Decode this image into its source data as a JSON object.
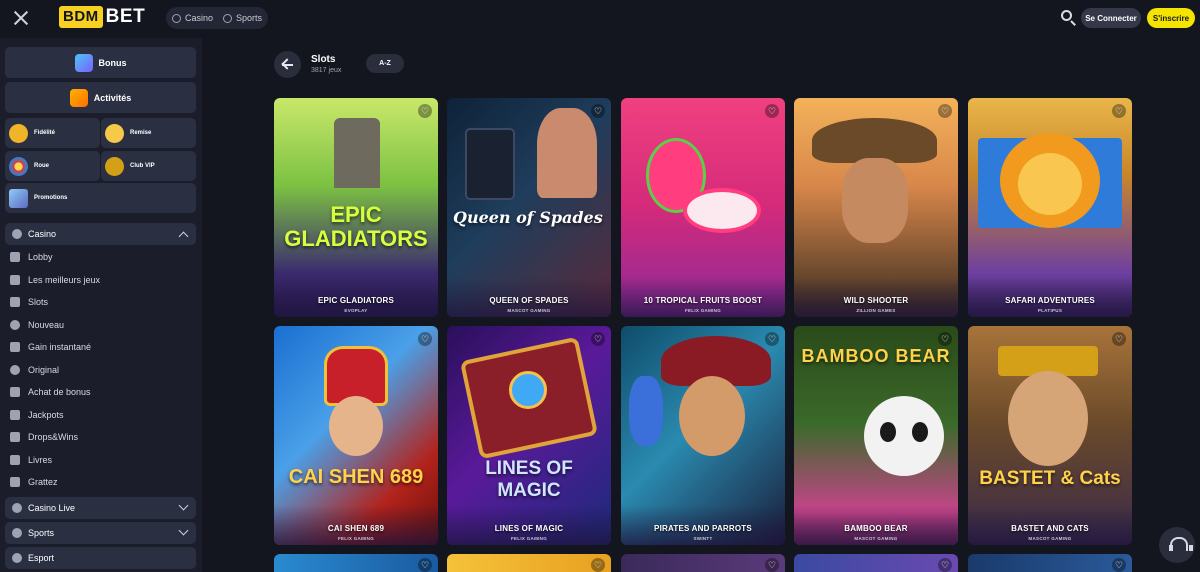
{
  "topbar": {
    "logo_box": "BDM",
    "logo_rest": "BET",
    "modes": [
      "Casino",
      "Sports"
    ],
    "login_label": "Se Connecter",
    "signup_label": "S'inscrire"
  },
  "sidebar": {
    "big_buttons": [
      "Bonus",
      "Activités"
    ],
    "small_buttons": [
      "Fidélité",
      "Remise",
      "Roue",
      "Club VIP",
      "Promotions"
    ],
    "casino_section": "Casino",
    "casino_links": [
      "Lobby",
      "Les meilleurs jeux",
      "Slots",
      "Nouveau",
      "Gain instantané",
      "Original",
      "Achat de bonus",
      "Jackpots",
      "Drops&Wins",
      "Livres",
      "Grattez"
    ],
    "bottom_sections": [
      "Casino Live",
      "Sports",
      "Esport"
    ]
  },
  "main": {
    "title": "Slots",
    "count": "3817 jeux",
    "sort_label": "A-Z",
    "games": [
      {
        "name": "EPIC GLADIATORS",
        "provider": "EVOPLAY",
        "art_text": "EPIC GLADIATORS"
      },
      {
        "name": "QUEEN OF SPADES",
        "provider": "MASCOT GAMING",
        "art_text": "Queen of Spades"
      },
      {
        "name": "10 TROPICAL FRUITS BOOST",
        "provider": "FELIX GAMING",
        "art_text": ""
      },
      {
        "name": "WILD SHOOTER",
        "provider": "ZILLION GAMES",
        "art_text": ""
      },
      {
        "name": "SAFARI ADVENTURES",
        "provider": "PLATIPUS",
        "art_text": ""
      },
      {
        "name": "CAI SHEN 689",
        "provider": "FELIX GAMING",
        "art_text": "CAI SHEN 689"
      },
      {
        "name": "LINES OF MAGIC",
        "provider": "FELIX GAMING",
        "art_text": "LINES OF MAGIC"
      },
      {
        "name": "PIRATES AND PARROTS",
        "provider": "SWINTT",
        "art_text": ""
      },
      {
        "name": "BAMBOO BEAR",
        "provider": "MASCOT GAMING",
        "art_text": "BAMBOO BEAR"
      },
      {
        "name": "BASTET AND CATS",
        "provider": "MASCOT GAMING",
        "art_text": "BASTET & Cats"
      }
    ]
  },
  "colors": {
    "background": "#14161f",
    "sidebar": "#1b1e2a",
    "accent_yellow": "#f5e400",
    "panel": "#2a3042"
  },
  "icons": [
    "close-icon",
    "search-icon",
    "heart-icon",
    "back-arrow-icon",
    "chevron-up-icon",
    "chevron-down-icon",
    "headset-icon"
  ]
}
